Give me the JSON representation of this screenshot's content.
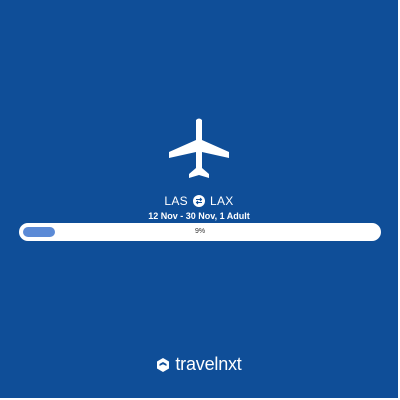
{
  "trip": {
    "origin": "LAS",
    "destination": "LAX",
    "details": "12 Nov - 30 Nov, 1 Adult"
  },
  "progress": {
    "fraction": 0.09,
    "label": "9%"
  },
  "brand": {
    "logo_text": "travelnxt"
  },
  "icons": {
    "plane": "airplane-icon",
    "swap": "swap-arrows-icon",
    "brand_logo": "travelnxt-logo-icon"
  },
  "colors": {
    "background": "#0f4e98",
    "progress_fill": "#5b8ad6"
  }
}
